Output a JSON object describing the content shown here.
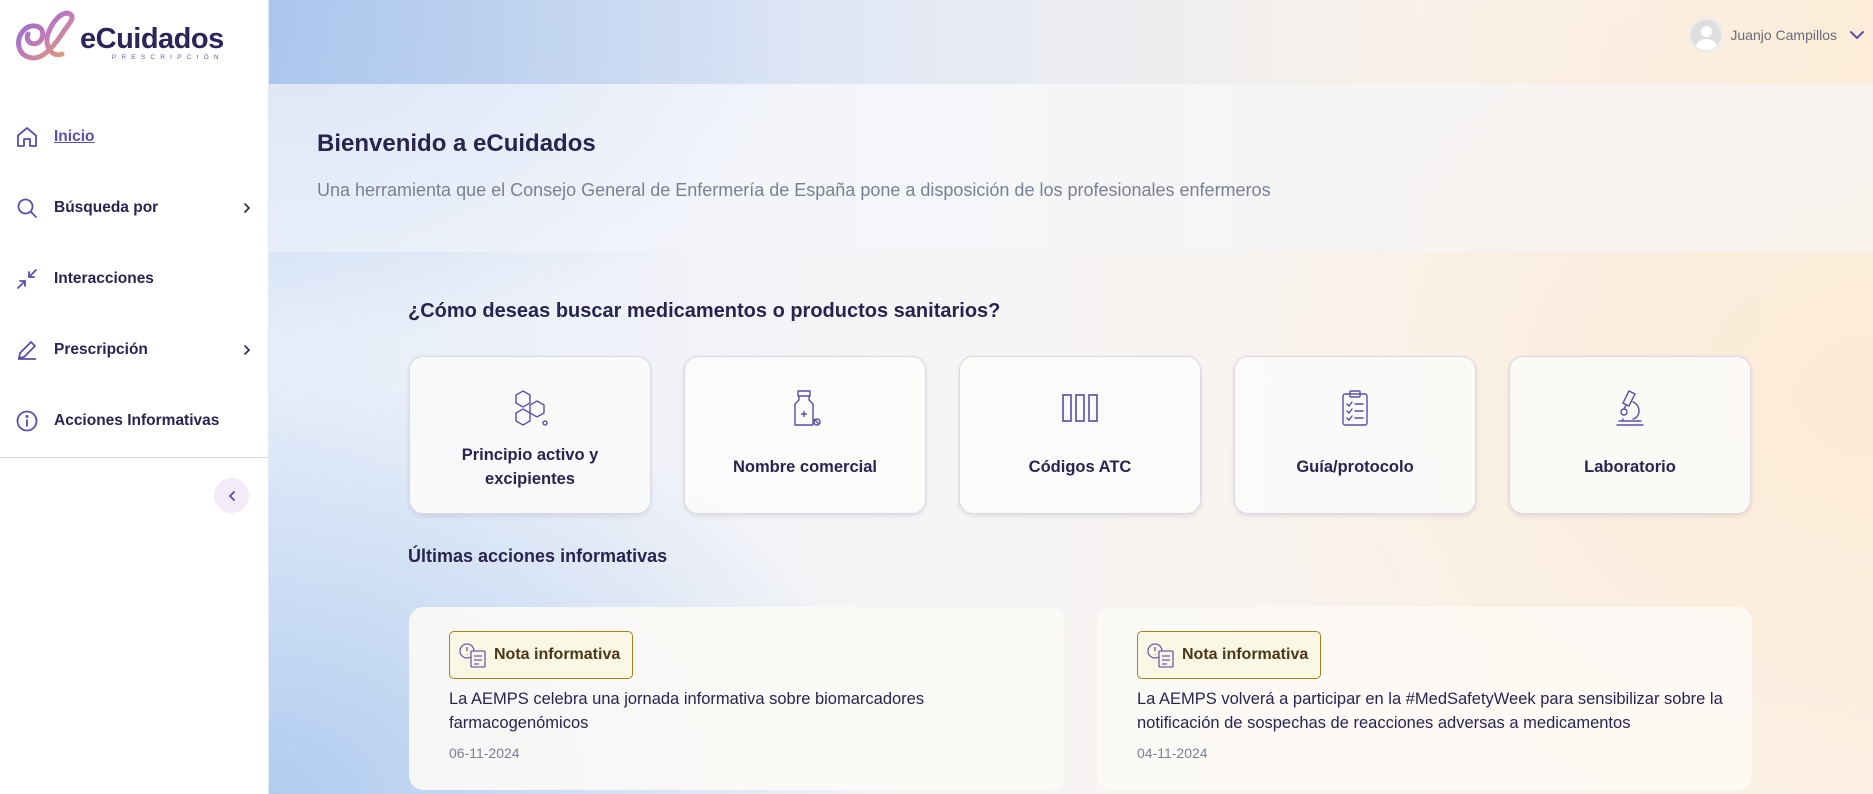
{
  "brand": {
    "name": "eCuidados",
    "subtitle": "PRESCRIPCIÓN"
  },
  "sidebar": {
    "items": [
      {
        "label": "Inicio",
        "icon": "home-icon",
        "active": true
      },
      {
        "label": "Búsqueda por",
        "icon": "search-icon",
        "has_submenu": true
      },
      {
        "label": "Interacciones",
        "icon": "arrows-in-icon"
      },
      {
        "label": "Prescripción",
        "icon": "pencil-icon",
        "has_submenu": true
      },
      {
        "label": "Acciones Informativas",
        "icon": "info-icon"
      }
    ]
  },
  "user": {
    "name": "Juanjo Campillos"
  },
  "welcome": {
    "title": "Bienvenido a eCuidados",
    "subtitle": "Una herramienta que el Consejo General de Enfermería de España pone a disposición de los profesionales enfermeros"
  },
  "search": {
    "title": "¿Cómo deseas buscar medicamentos o productos sanitarios?",
    "cards": [
      {
        "label": "Principio activo y excipientes",
        "icon": "molecule-icon"
      },
      {
        "label": "Nombre comercial",
        "icon": "medicine-bottle-icon"
      },
      {
        "label": "Códigos ATC",
        "icon": "columns-icon"
      },
      {
        "label": "Guía/protocolo",
        "icon": "clipboard-list-icon"
      },
      {
        "label": "Laboratorio",
        "icon": "microscope-icon"
      }
    ]
  },
  "latest": {
    "title": "Últimas acciones informativas",
    "items": [
      {
        "badge": "Nota informativa",
        "text": "La AEMPS celebra una jornada informativa sobre biomarcadores farmacogenómicos",
        "date": "06-11-2024"
      },
      {
        "badge": "Nota informativa",
        "text": "La AEMPS volverá a participar en la #MedSafetyWeek para sensibilizar sobre la notificación de sospechas de reacciones adversas a medicamentos",
        "date": "04-11-2024"
      }
    ]
  },
  "colors": {
    "primary": "#2a2350",
    "accent": "#5b4ea8",
    "badge_border": "#a4811b"
  }
}
